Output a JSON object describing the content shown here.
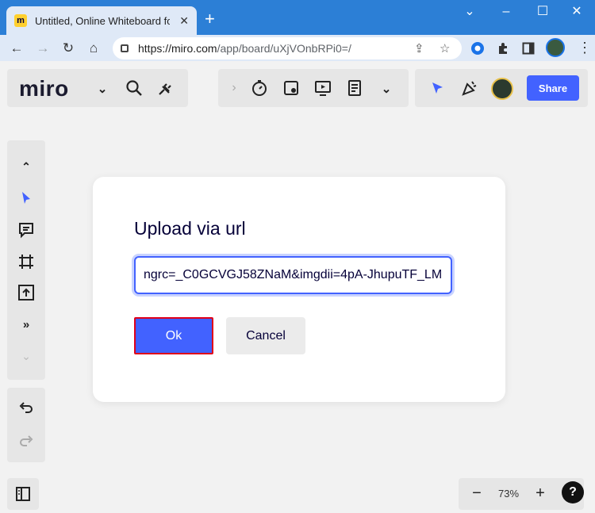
{
  "browser": {
    "tab_title": "Untitled, Online Whiteboard for V",
    "favicon_letter": "m",
    "url_host": "https://miro.com",
    "url_path": "/app/board/uXjVOnbRPi0=/"
  },
  "toolbar": {
    "logo": "miro",
    "share_label": "Share"
  },
  "zoom": {
    "level": "73%",
    "help_label": "?"
  },
  "modal": {
    "title": "Upload via url",
    "input_value": "ngrc=_C0GCVGJ58ZNaM&imgdii=4pA-JhupuTF_LM",
    "ok_label": "Ok",
    "cancel_label": "Cancel"
  },
  "colors": {
    "accent": "#4262ff",
    "highlight_border": "#e0001a"
  }
}
